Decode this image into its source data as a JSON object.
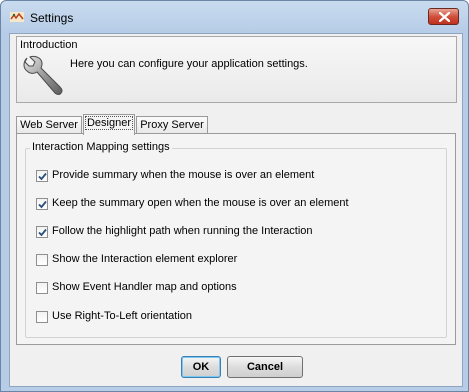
{
  "window": {
    "title": "Settings",
    "close_icon": "close-icon",
    "app_icon": "app-icon"
  },
  "intro": {
    "title": "Introduction",
    "text": "Here you can configure your application settings.",
    "icon": "wrench-icon"
  },
  "tabs": [
    {
      "label": "Web Server",
      "active": false
    },
    {
      "label": "Designer",
      "active": true
    },
    {
      "label": "Proxy Server",
      "active": false
    }
  ],
  "group": {
    "title": "Interaction Mapping settings",
    "options": [
      {
        "label": "Provide summary when the mouse is over an element",
        "checked": true
      },
      {
        "label": "Keep the summary open when the mouse is over an element",
        "checked": true
      },
      {
        "label": "Follow the highlight path when running the Interaction",
        "checked": true
      },
      {
        "label": "Show the Interaction element explorer",
        "checked": false
      },
      {
        "label": "Show Event Handler map and options",
        "checked": false
      },
      {
        "label": "Use Right-To-Left orientation",
        "checked": false
      }
    ]
  },
  "buttons": {
    "ok": "OK",
    "cancel": "Cancel"
  },
  "colors": {
    "title_bar": "#b7cde7",
    "close_button": "#c0321f",
    "check": "#2a4e7d"
  }
}
